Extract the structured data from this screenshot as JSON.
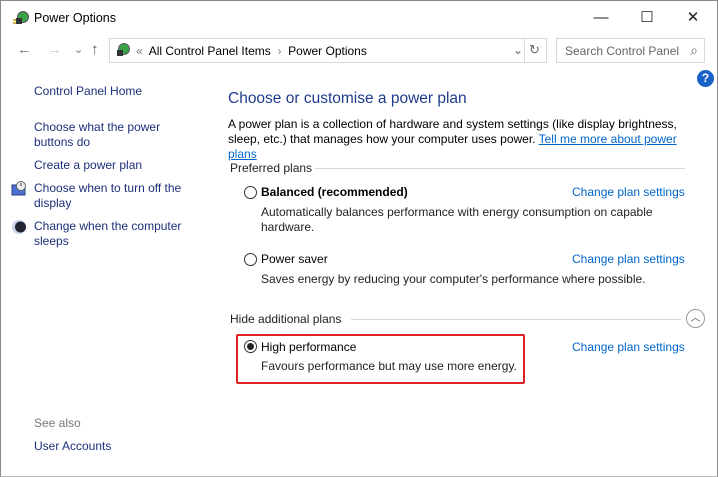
{
  "window": {
    "title": "Power Options",
    "minimize": "—",
    "maximize": "☐",
    "close": "✕"
  },
  "toolbar": {
    "back": "←",
    "forward": "→",
    "recent": "⌄",
    "up": "↑",
    "crumb_sep": "«",
    "crumbs": [
      "All Control Panel Items",
      "Power Options"
    ],
    "arrow": "›",
    "dropdown": "⌄",
    "refresh": "↻",
    "search_placeholder": "Search Control Panel",
    "search_icon": "⌕"
  },
  "help": "?",
  "sidebar": {
    "home": "Control Panel Home",
    "items": [
      "Choose what the power buttons do",
      "Create a power plan",
      "Choose when to turn off the display",
      "Change when the computer sleeps"
    ],
    "see_also": "See also",
    "user_accounts": "User Accounts"
  },
  "main": {
    "heading": "Choose or customise a power plan",
    "description": "A power plan is a collection of hardware and system settings (like display brightness, sleep, etc.) that manages how your computer uses power. ",
    "learn_more": "Tell me more about power plans",
    "preferred_label": "Preferred plans",
    "hidden_label": "Hide additional plans",
    "plans": [
      {
        "name": "Balanced (recommended)",
        "desc": "Automatically balances performance with energy consumption on capable hardware.",
        "selected": false,
        "change": "Change plan settings"
      },
      {
        "name": "Power saver",
        "desc": "Saves energy by reducing your computer's performance where possible.",
        "selected": false,
        "change": "Change plan settings"
      },
      {
        "name": "High performance",
        "desc": "Favours performance but may use more energy.",
        "selected": true,
        "change": "Change plan settings"
      }
    ]
  },
  "colors": {
    "highlight": "#e02020",
    "link": "#0066cc",
    "heading": "#1e3b8c"
  }
}
